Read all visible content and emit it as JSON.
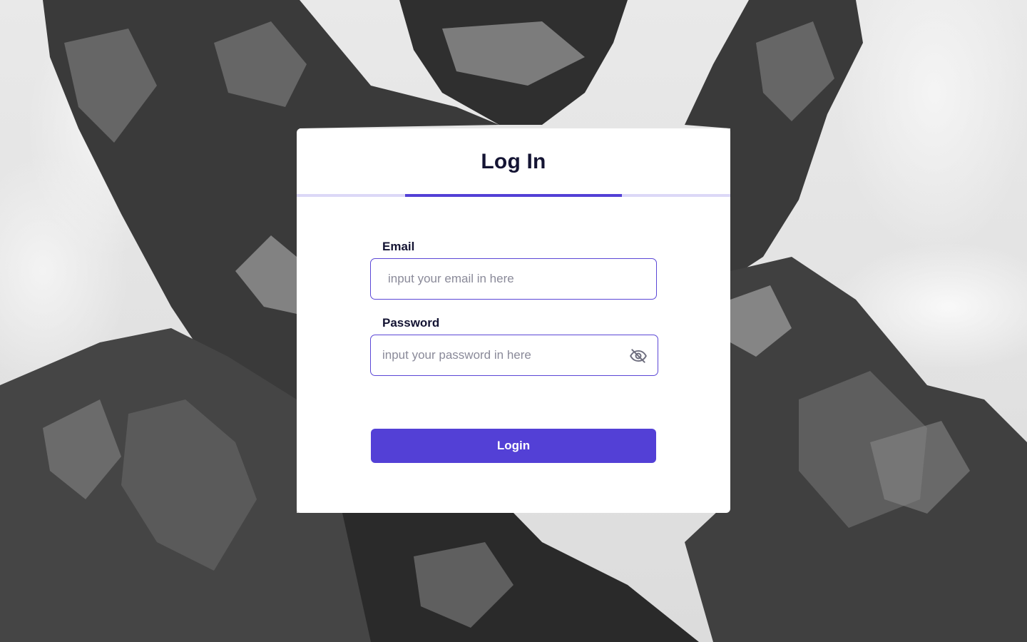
{
  "form": {
    "title": "Log In",
    "email_label": "Email",
    "email_placeholder": "input your email in here",
    "email_value": "",
    "password_label": "Password",
    "password_placeholder": "input your password in here",
    "password_value": "",
    "login_label": "Login",
    "icons": {
      "password_toggle": "eye-off-icon"
    }
  },
  "theme": {
    "accent": "#5340d6",
    "accent_light": "#dcd8f7",
    "title_color": "#141433"
  }
}
